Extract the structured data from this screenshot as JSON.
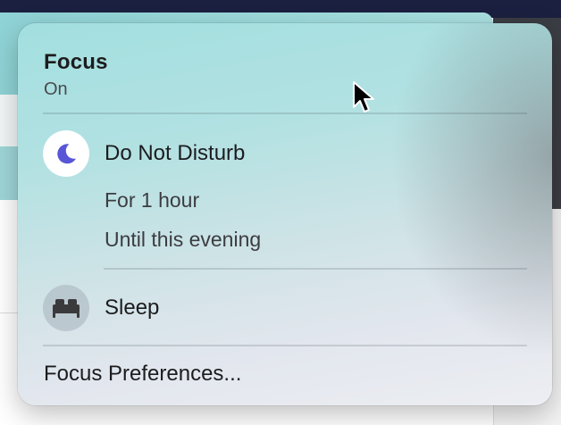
{
  "focus_menu": {
    "title": "Focus",
    "status": "On",
    "modes": [
      {
        "label": "Do Not Disturb",
        "icon": "moon-icon",
        "active": true,
        "icon_color": "#5856d6",
        "options": [
          "For 1 hour",
          "Until this evening"
        ]
      },
      {
        "label": "Sleep",
        "icon": "bed-icon",
        "active": false,
        "icon_color": "#3a3a3c"
      }
    ],
    "preferences_label": "Focus Preferences..."
  },
  "colors": {
    "panel_tint": "#a3dfe0",
    "dnd_accent": "#5856d6",
    "menubar": "#1b2040"
  }
}
